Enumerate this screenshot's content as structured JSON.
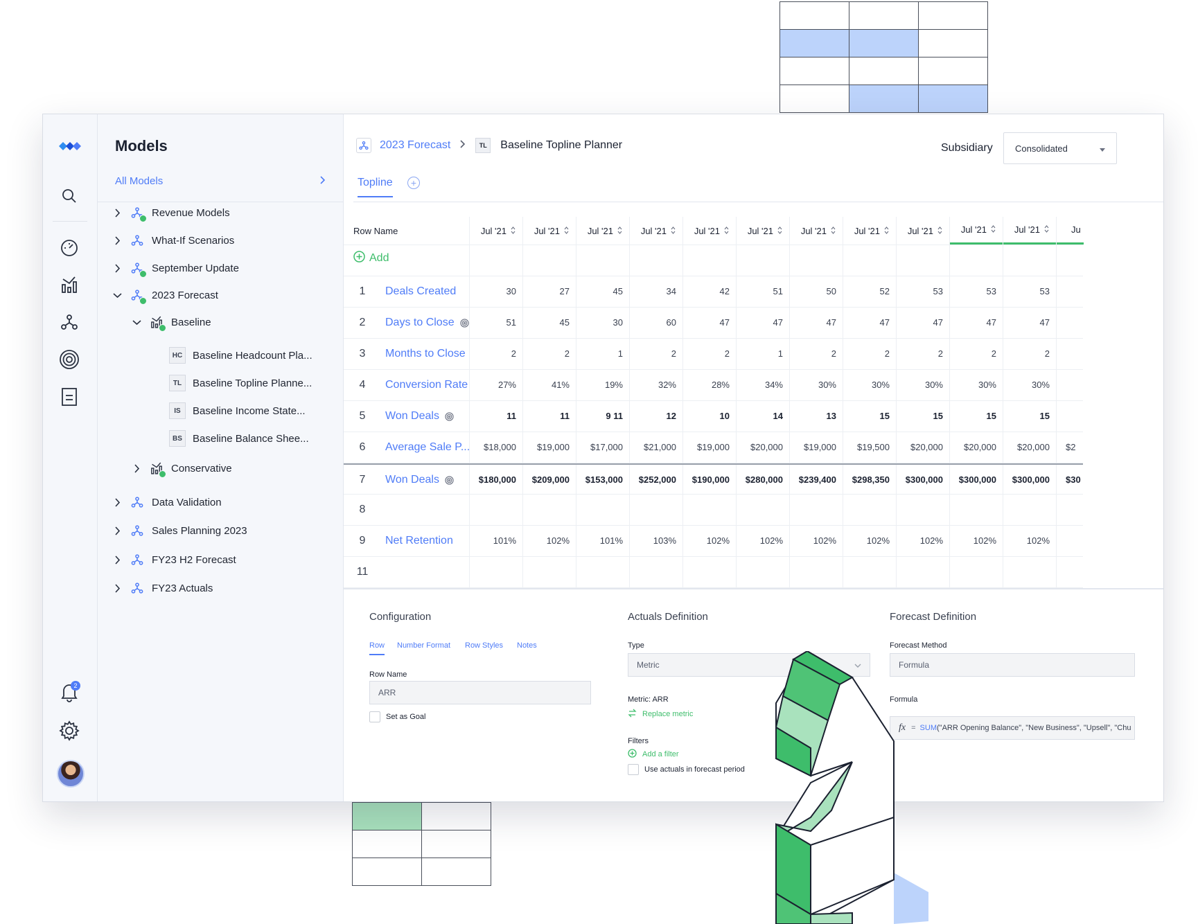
{
  "sidebar": {
    "title": "Models",
    "all_models": "All Models",
    "items": [
      {
        "label": "Revenue Models"
      },
      {
        "label": "What-If Scenarios"
      },
      {
        "label": "September Update"
      },
      {
        "label": "2023 Forecast"
      },
      {
        "label": "Baseline"
      },
      {
        "label": "Baseline Headcount Pla...",
        "abbr": "HC"
      },
      {
        "label": "Baseline Topline Planne...",
        "abbr": "TL"
      },
      {
        "label": "Baseline Income State...",
        "abbr": "IS"
      },
      {
        "label": "Baseline Balance Shee...",
        "abbr": "BS"
      },
      {
        "label": "Conservative"
      },
      {
        "label": "Data Validation"
      },
      {
        "label": "Sales Planning 2023"
      },
      {
        "label": "FY23 H2 Forecast"
      },
      {
        "label": "FY23 Actuals"
      }
    ],
    "notification_count": "2"
  },
  "header": {
    "breadcrumb_parent": "2023 Forecast",
    "breadcrumb_abbr": "TL",
    "breadcrumb_current": "Baseline Topline Planner",
    "subsidiary_label": "Subsidiary",
    "subsidiary_value": "Consolidated",
    "tab": "Topline"
  },
  "table": {
    "row_name_header": "Row Name",
    "col_header": "Jul '21",
    "last_col_header": "Ju",
    "add_label": "Add",
    "rows": [
      {
        "num": "1",
        "name": "Deals Created",
        "values": [
          "30",
          "27",
          "45",
          "34",
          "42",
          "51",
          "50",
          "52",
          "53",
          "53",
          "53"
        ]
      },
      {
        "num": "2",
        "name": "Days to Close",
        "target": true,
        "values": [
          "51",
          "45",
          "30",
          "60",
          "47",
          "47",
          "47",
          "47",
          "47",
          "47",
          "47"
        ]
      },
      {
        "num": "3",
        "name": "Months to Close",
        "values": [
          "2",
          "2",
          "1",
          "2",
          "2",
          "1",
          "2",
          "2",
          "2",
          "2",
          "2"
        ]
      },
      {
        "num": "4",
        "name": "Conversion Rate",
        "values": [
          "27%",
          "41%",
          "19%",
          "32%",
          "28%",
          "34%",
          "30%",
          "30%",
          "30%",
          "30%",
          "30%"
        ]
      },
      {
        "num": "5",
        "name": "Won Deals",
        "target": true,
        "bold": true,
        "values": [
          "11",
          "11",
          "9  11",
          "12",
          "10",
          "14",
          "13",
          "15",
          "15",
          "15",
          "15"
        ]
      },
      {
        "num": "6",
        "name": "Average Sale P...",
        "values": [
          "$18,000",
          "$19,000",
          "$17,000",
          "$21,000",
          "$19,000",
          "$20,000",
          "$19,000",
          "$19,500",
          "$20,000",
          "$20,000",
          "$20,000"
        ],
        "overflow": "$2"
      },
      {
        "num": "7",
        "name": "Won Deals",
        "target": true,
        "bold": true,
        "values": [
          "$180,000",
          "$209,000",
          "$153,000",
          "$252,000",
          "$190,000",
          "$280,000",
          "$239,400",
          "$298,350",
          "$300,000",
          "$300,000",
          "$300,000"
        ],
        "overflow": "$30"
      },
      {
        "num": "8",
        "name": "",
        "values": []
      },
      {
        "num": "9",
        "name": "Net Retention",
        "values": [
          "101%",
          "102%",
          "101%",
          "103%",
          "102%",
          "102%",
          "102%",
          "102%",
          "102%",
          "102%",
          "102%"
        ]
      },
      {
        "num": "11",
        "name": "",
        "values": []
      }
    ]
  },
  "config": {
    "configuration_title": "Configuration",
    "tabs": [
      "Row",
      "Number Format",
      "Row Styles",
      "Notes"
    ],
    "row_name_label": "Row Name",
    "row_name_value": "ARR",
    "set_as_goal": "Set as Goal",
    "actuals_title": "Actuals Definition",
    "type_label": "Type",
    "type_value": "Metric",
    "metric_label": "Metric: ARR",
    "replace_metric": "Replace metric",
    "filters_label": "Filters",
    "add_filter": "Add a filter",
    "use_actuals": "Use actuals in forecast period",
    "forecast_title": "Forecast Definition",
    "forecast_method_label": "Forecast Method",
    "forecast_method_value": "Formula",
    "formula_label": "Formula",
    "formula_fx": "fx",
    "formula_eq": "=",
    "formula_fn": "SUM",
    "formula_args": "(\"ARR Opening Balance\", \"New Business\", \"Upsell\", \"Chu"
  },
  "colors": {
    "accent": "#4f7cf7",
    "success": "#3ebd6b",
    "deco_blue": "#bcd3fb",
    "deco_green": "#a9e2bd"
  }
}
